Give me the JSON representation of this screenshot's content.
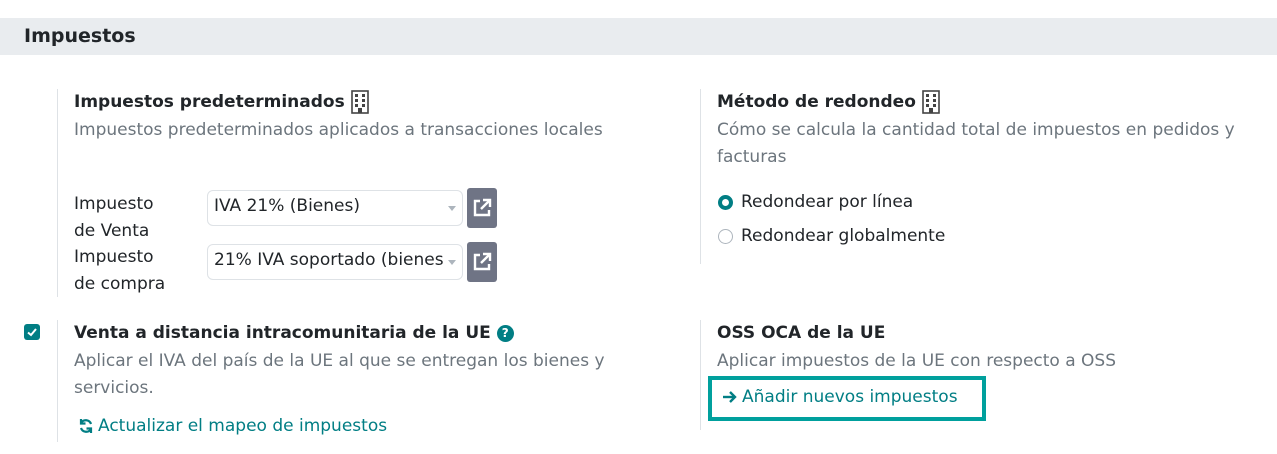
{
  "section": {
    "title": "Impuestos"
  },
  "default_taxes": {
    "title": "Impuestos predeterminados",
    "description": "Impuestos predeterminados aplicados a transacciones locales",
    "sale_label": "Impuesto de Venta",
    "sale_value": "IVA 21% (Bienes)",
    "purchase_label": "Impuesto de compra",
    "purchase_value": "21% IVA soportado (bienes"
  },
  "rounding": {
    "title": "Método de redondeo",
    "description": "Cómo se calcula la cantidad total de impuestos en pedidos y facturas",
    "options": [
      {
        "label": "Redondear por línea",
        "checked": true
      },
      {
        "label": "Redondear globalmente",
        "checked": false
      }
    ]
  },
  "eu_distance": {
    "title": "Venta a distancia intracomunitaria de la UE",
    "description": "Aplicar el IVA del país de la UE al que se entregan los bienes y servicios.",
    "checked": true,
    "link": "Actualizar el mapeo de impuestos"
  },
  "oss": {
    "title": "OSS OCA de la UE",
    "description": "Aplicar impuestos de la UE con respecto a OSS",
    "link": "Añadir nuevos impuestos"
  },
  "colors": {
    "accent": "#017e84",
    "highlight": "#00a09d",
    "button": "#6f7485"
  }
}
